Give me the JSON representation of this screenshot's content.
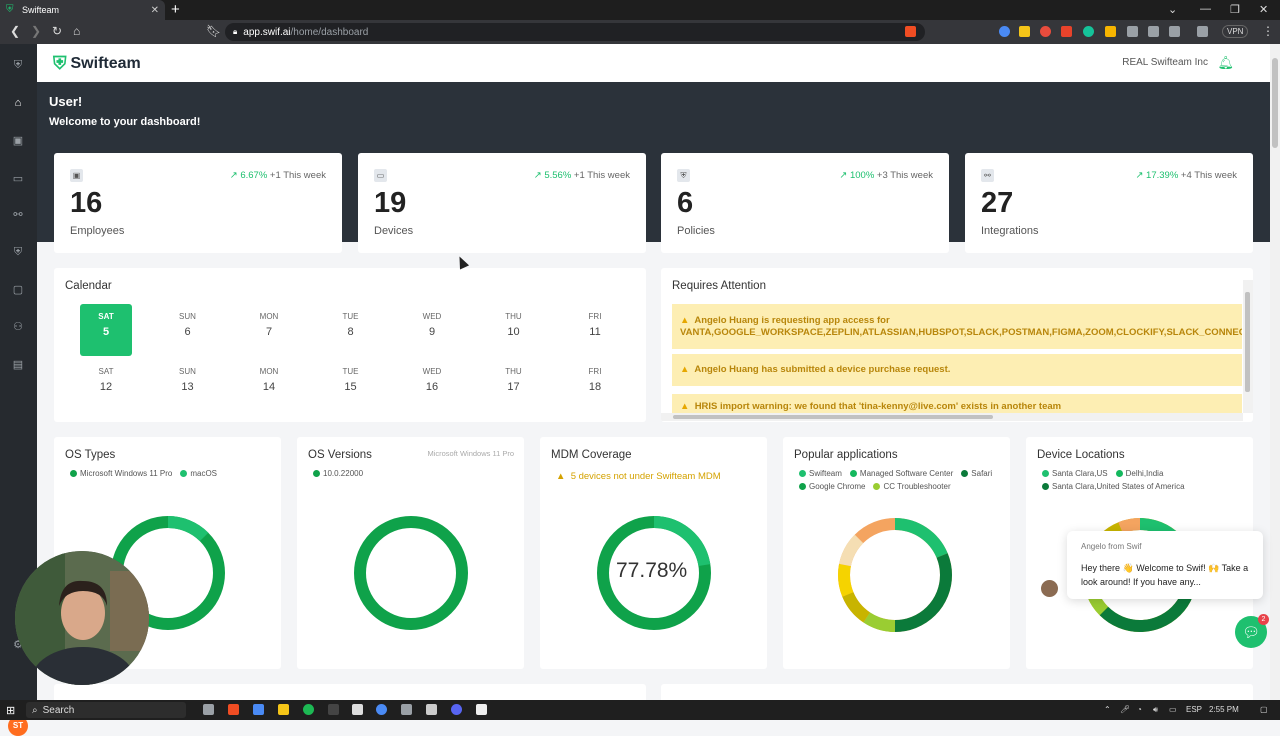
{
  "browser": {
    "tab_title": "Swifteam",
    "url_host": "app.swif.ai",
    "url_path": "/home/dashboard",
    "vpn_label": "VPN"
  },
  "app": {
    "brand": "Swifteam",
    "org": "REAL Swifteam Inc",
    "greeting": "User!",
    "welcome": "Welcome to your dashboard!"
  },
  "stats": [
    {
      "pct": "6.67%",
      "week": "+1 This week",
      "value": "16",
      "label": "Employees"
    },
    {
      "pct": "5.56%",
      "week": "+1 This week",
      "value": "19",
      "label": "Devices"
    },
    {
      "pct": "100%",
      "week": "+3 This week",
      "value": "6",
      "label": "Policies"
    },
    {
      "pct": "17.39%",
      "week": "+4 This week",
      "value": "27",
      "label": "Integrations"
    }
  ],
  "calendar": {
    "title": "Calendar",
    "week1": [
      {
        "dow": "SAT",
        "day": "5",
        "selected": true
      },
      {
        "dow": "SUN",
        "day": "6"
      },
      {
        "dow": "MON",
        "day": "7"
      },
      {
        "dow": "TUE",
        "day": "8"
      },
      {
        "dow": "WED",
        "day": "9"
      },
      {
        "dow": "THU",
        "day": "10"
      },
      {
        "dow": "FRI",
        "day": "11"
      }
    ],
    "week2": [
      {
        "dow": "SAT",
        "day": "12"
      },
      {
        "dow": "SUN",
        "day": "13"
      },
      {
        "dow": "MON",
        "day": "14"
      },
      {
        "dow": "TUE",
        "day": "15"
      },
      {
        "dow": "WED",
        "day": "16"
      },
      {
        "dow": "THU",
        "day": "17"
      },
      {
        "dow": "FRI",
        "day": "18"
      }
    ]
  },
  "attention": {
    "title": "Requires Attention",
    "items": [
      "Angelo Huang is requesting app access for",
      "VANTA,GOOGLE_WORKSPACE,ZEPLIN,ATLASSIAN,HUBSPOT,SLACK,POSTMAN,FIGMA,ZOOM,CLOCKIFY,SLACK_CONNECT,GIT",
      "Angelo Huang has submitted a device purchase request.",
      "HRIS import warning: we found that 'tina-kenny@live.com' exists in another team"
    ]
  },
  "os_types": {
    "title": "OS Types",
    "legend": [
      "Microsoft Windows 11 Pro",
      "macOS"
    ]
  },
  "os_versions": {
    "title": "OS Versions",
    "hint": "Microsoft Windows 11 Pro",
    "legend": [
      "10.0.22000"
    ]
  },
  "mdm": {
    "title": "MDM Coverage",
    "warning": "5 devices not under Swifteam MDM",
    "percent": "77.78%"
  },
  "apps": {
    "title": "Popular applications",
    "legend": [
      "Swifteam",
      "Managed Software Center",
      "Safari",
      "Google Chrome",
      "CC Troubleshooter"
    ]
  },
  "locations": {
    "title": "Device Locations",
    "legend": [
      "Santa Clara,US",
      "Delhi,India",
      "Santa Clara,United States of America"
    ]
  },
  "chat": {
    "from": "Angelo from Swif",
    "message": "Hey there 👋 Welcome to Swif! 🙌 Take a look around! If you have any...",
    "badge": "2"
  },
  "taskbar": {
    "search": "Search",
    "lang": "ESP",
    "time": "2:55 PM"
  },
  "rail": {
    "avatar": "ST"
  },
  "colors": {
    "accent": "#1ec06f",
    "hero": "#2b323a",
    "alert_bg": "#fdeeb3"
  }
}
